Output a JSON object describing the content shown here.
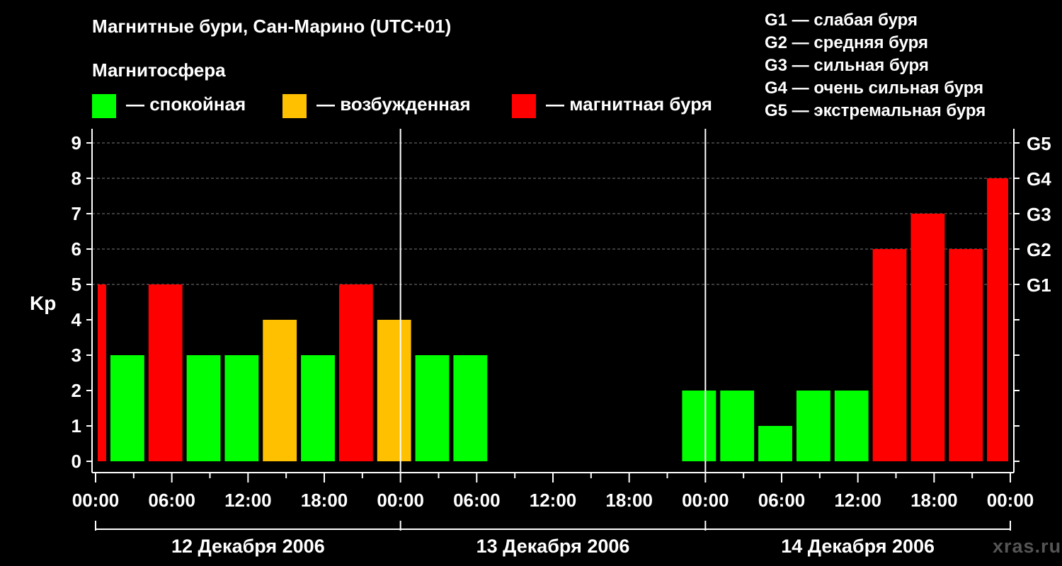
{
  "title": "Магнитные бури, Сан-Марино (UTC+01)",
  "legend": {
    "title": "Магнитосфера",
    "items": [
      {
        "label": "— спокойная",
        "color": "#00ff00"
      },
      {
        "label": "— возбужденная",
        "color": "#ffc000"
      },
      {
        "label": "— магнитная буря",
        "color": "#ff0000"
      }
    ]
  },
  "storm_scale": [
    "G1 — слабая буря",
    "G2 — средняя буря",
    "G3 — сильная буря",
    "G4 — очень сильная буря",
    "G5 — экстремальная буря"
  ],
  "watermark": "xras.ru",
  "chart_data": {
    "type": "bar",
    "ylabel": "Kp",
    "ylim": [
      0,
      9
    ],
    "yticks": [
      0,
      1,
      2,
      3,
      4,
      5,
      6,
      7,
      8,
      9
    ],
    "right_ticks": [
      {
        "value": 5,
        "label": "G1"
      },
      {
        "value": 6,
        "label": "G2"
      },
      {
        "value": 7,
        "label": "G3"
      },
      {
        "value": 8,
        "label": "G4"
      },
      {
        "value": 9,
        "label": "G5"
      }
    ],
    "xticks": [
      "00:00",
      "06:00",
      "12:00",
      "18:00",
      "00:00",
      "06:00",
      "12:00",
      "18:00",
      "00:00",
      "06:00",
      "12:00",
      "18:00",
      "00:00"
    ],
    "days": [
      "12 Декабря 2006",
      "13 Декабря 2006",
      "14 Декабря 2006"
    ],
    "grid": true,
    "colors": {
      "quiet": "#00ff00",
      "active": "#ffc000",
      "storm": "#ff0000"
    },
    "bars": [
      {
        "start_hour": 0,
        "end_hour": 1,
        "kp": 5,
        "state": "storm"
      },
      {
        "start_hour": 1,
        "end_hour": 4,
        "kp": 3,
        "state": "quiet"
      },
      {
        "start_hour": 4,
        "end_hour": 7,
        "kp": 5,
        "state": "storm"
      },
      {
        "start_hour": 7,
        "end_hour": 10,
        "kp": 3,
        "state": "quiet"
      },
      {
        "start_hour": 10,
        "end_hour": 13,
        "kp": 3,
        "state": "quiet"
      },
      {
        "start_hour": 13,
        "end_hour": 16,
        "kp": 4,
        "state": "active"
      },
      {
        "start_hour": 16,
        "end_hour": 19,
        "kp": 3,
        "state": "quiet"
      },
      {
        "start_hour": 19,
        "end_hour": 22,
        "kp": 5,
        "state": "storm"
      },
      {
        "start_hour": 22,
        "end_hour": 25,
        "kp": 4,
        "state": "active"
      },
      {
        "start_hour": 25,
        "end_hour": 28,
        "kp": 3,
        "state": "quiet"
      },
      {
        "start_hour": 28,
        "end_hour": 31,
        "kp": 3,
        "state": "quiet"
      },
      {
        "start_hour": 46,
        "end_hour": 49,
        "kp": 2,
        "state": "quiet"
      },
      {
        "start_hour": 49,
        "end_hour": 52,
        "kp": 2,
        "state": "quiet"
      },
      {
        "start_hour": 52,
        "end_hour": 55,
        "kp": 1,
        "state": "quiet"
      },
      {
        "start_hour": 55,
        "end_hour": 58,
        "kp": 2,
        "state": "quiet"
      },
      {
        "start_hour": 58,
        "end_hour": 61,
        "kp": 2,
        "state": "quiet"
      },
      {
        "start_hour": 61,
        "end_hour": 64,
        "kp": 6,
        "state": "storm"
      },
      {
        "start_hour": 64,
        "end_hour": 67,
        "kp": 7,
        "state": "storm"
      },
      {
        "start_hour": 67,
        "end_hour": 70,
        "kp": 6,
        "state": "storm"
      },
      {
        "start_hour": 70,
        "end_hour": 72,
        "kp": 8,
        "state": "storm"
      }
    ]
  }
}
